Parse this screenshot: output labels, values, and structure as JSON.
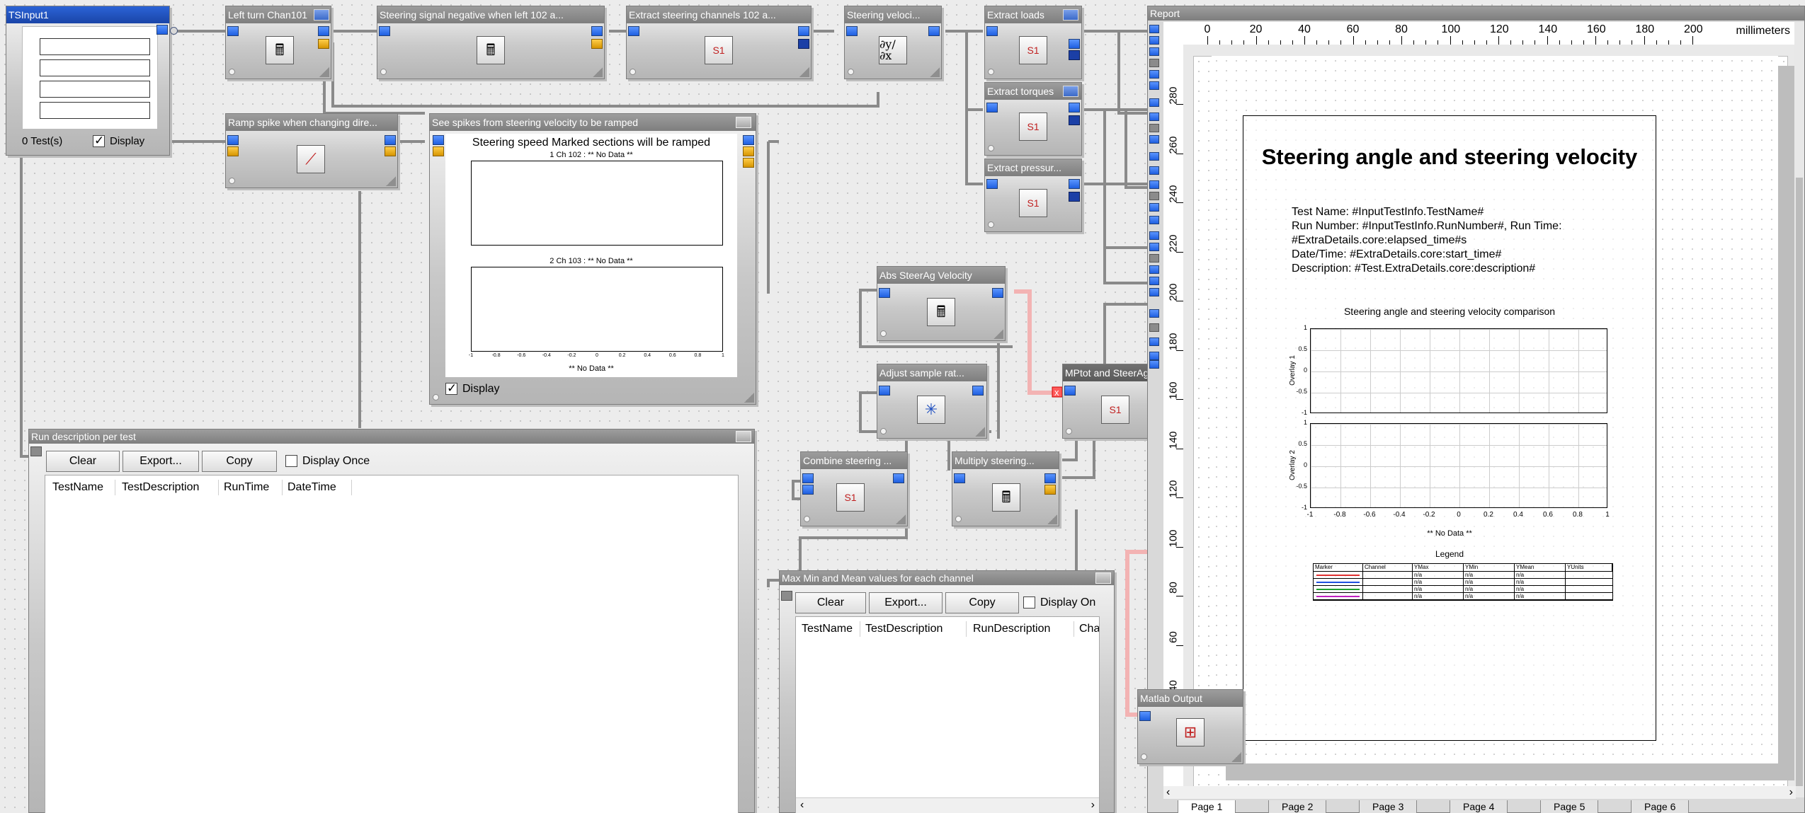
{
  "blocks": {
    "tsinput": {
      "title": "TSInput1",
      "tests": "0 Test(s)",
      "display": "Display"
    },
    "left_turn": {
      "title": "Left turn Chan101"
    },
    "steer_neg": {
      "title": "Steering signal negative when left 102 a..."
    },
    "extract_steer": {
      "title": "Extract steering channels 102 a..."
    },
    "steer_vel": {
      "title": "Steering veloci..."
    },
    "extract_loads": {
      "title": "Extract loads"
    },
    "extract_torques": {
      "title": "Extract torques"
    },
    "extract_pressure": {
      "title": "Extract pressur..."
    },
    "ramp_spike": {
      "title": "Ramp spike when changing dire..."
    },
    "see_spikes": {
      "title": "See spikes from steering velocity to be ramped",
      "chart_title": "Steering speed Marked sections will be ramped",
      "plot1_label": "1 Ch 102 : ** No Data **",
      "plot2_label": "2 Ch 103 : ** No Data **",
      "x_ticks": [
        "-1",
        "-0.8",
        "-0.6",
        "-0.4",
        "-0.2",
        "0",
        "0.2",
        "0.4",
        "0.6",
        "0.8",
        "1"
      ],
      "xlabel": "** No Data **",
      "display": "Display"
    },
    "abs_steer": {
      "title": "Abs SteerAg Velocity"
    },
    "adjust_sample": {
      "title": "Adjust sample rat..."
    },
    "mptot": {
      "title": "MPtot and SteerAg..."
    },
    "combine_steer": {
      "title": "Combine steering ..."
    },
    "multiply_steer": {
      "title": "Multiply steering..."
    },
    "matlab": {
      "title": "Matlab Output"
    }
  },
  "run_desc": {
    "title": "Run description per test",
    "buttons": {
      "clear": "Clear",
      "export": "Export...",
      "copy": "Copy"
    },
    "display_once": "Display Once",
    "columns": [
      "TestName",
      "TestDescription",
      "RunTime",
      "DateTime"
    ]
  },
  "maxmin": {
    "title": "Max Min and Mean values for each channel",
    "buttons": {
      "clear": "Clear",
      "export": "Export...",
      "copy": "Copy"
    },
    "display_once": "Display On",
    "columns": [
      "TestName",
      "TestDescription",
      "RunDescription",
      "Chann"
    ]
  },
  "report": {
    "title": "Report",
    "units": "millimeters",
    "h_ruler": [
      "0",
      "20",
      "40",
      "60",
      "80",
      "100",
      "120",
      "140",
      "160",
      "180",
      "200"
    ],
    "v_ruler": [
      "280",
      "260",
      "240",
      "220",
      "200",
      "180",
      "160",
      "140",
      "120",
      "100",
      "80",
      "60",
      "40"
    ],
    "heading": "Steering angle and steering velocity",
    "info_lines": [
      "Test Name: #InputTestInfo.TestName#",
      "Run Number: #InputTestInfo.RunNumber#, Run Time:",
      "#ExtraDetails.core:elapsed_time#s",
      "Date/Time: #ExtraDetails.core:start_time#",
      "Description: #Test.ExtraDetails.core:description#"
    ],
    "chart_title": "Steering angle and steering velocity comparison",
    "overlay1": "Overlay 1",
    "overlay2": "Overlay 2",
    "y_ticks": [
      "1",
      "0.5",
      "0",
      "-0.5",
      "-1"
    ],
    "x_ticks": [
      "-1",
      "-0.8",
      "-0.6",
      "-0.4",
      "-0.2",
      "0",
      "0.2",
      "0.4",
      "0.6",
      "0.8",
      "1"
    ],
    "xlabel": "** No Data **",
    "legend_title": "Legend",
    "legend_cols": [
      "Marker",
      "Channel",
      "YMax",
      "YMin",
      "YMean",
      "YUnits"
    ],
    "legend_rows": [
      {
        "color": "#e03030",
        "ymax": "n/a",
        "ymin": "n/a",
        "ymean": "n/a"
      },
      {
        "color": "#2050e0",
        "ymax": "n/a",
        "ymin": "n/a",
        "ymean": "n/a"
      },
      {
        "color": "#20a030",
        "ymax": "n/a",
        "ymin": "n/a",
        "ymean": "n/a"
      },
      {
        "color": "#c020c0",
        "ymax": "n/a",
        "ymin": "n/a",
        "ymean": "n/a"
      }
    ],
    "page_tabs": [
      "Page 1",
      "Page 2",
      "Page 3",
      "Page 4",
      "Page 5",
      "Page 6"
    ]
  },
  "colors": {
    "port_blue": "#3b7af0",
    "port_gold": "#e8a800",
    "title_blue": "#2355c4",
    "error_wire": "#f2a0a0"
  }
}
